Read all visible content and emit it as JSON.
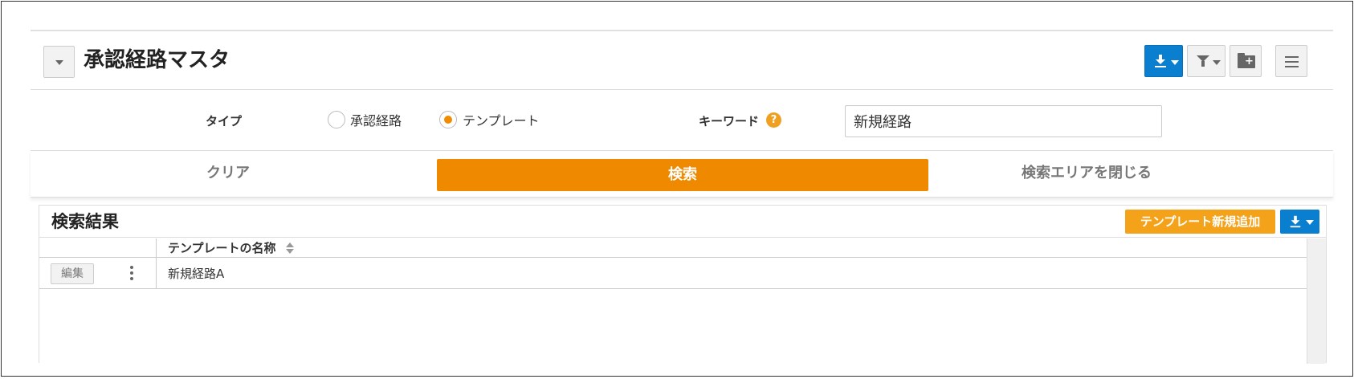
{
  "page": {
    "title": "承認経路マスタ"
  },
  "toolbar": {
    "download_icon": "download-icon",
    "filter_icon": "filter-icon",
    "folder_icon": "folder-plus-icon",
    "menu_icon": "menu-icon",
    "accent_color": "#0a7fcf"
  },
  "search": {
    "type_label": "タイプ",
    "type_options": [
      {
        "label": "承認経路",
        "selected": false
      },
      {
        "label": "テンプレート",
        "selected": true
      }
    ],
    "keyword_label": "キーワード",
    "keyword_help": "?",
    "keyword_value": "新規経路",
    "clear_label": "クリア",
    "search_label": "検索",
    "close_label": "検索エリアを閉じる",
    "search_color": "#ef8a00"
  },
  "results": {
    "title": "検索結果",
    "add_label": "テンプレート新規追加",
    "column_header": "テンプレートの名称",
    "rows": [
      {
        "edit_label": "編集",
        "name": "新規経路A"
      }
    ]
  }
}
